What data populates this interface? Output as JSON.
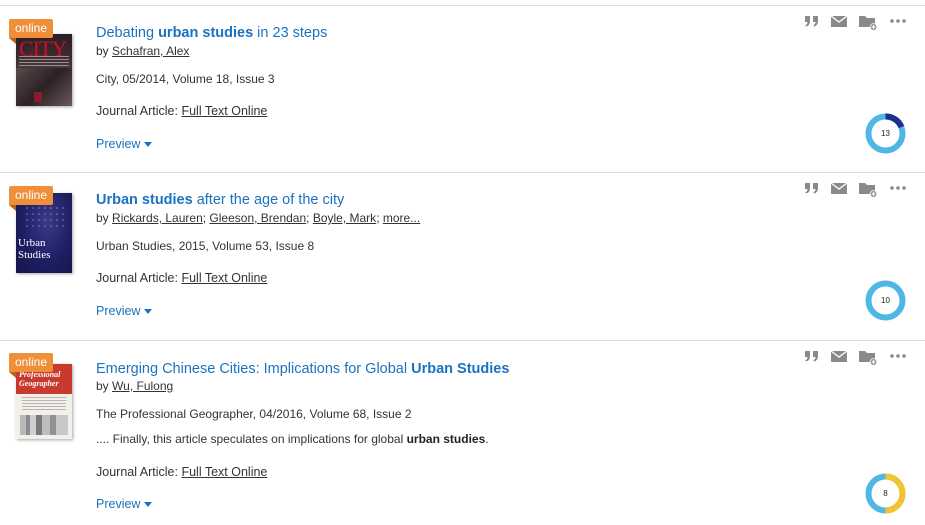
{
  "colors": {
    "link": "#1a73c2",
    "badge": "#f08f3a",
    "donut_blue": "#4fb7e6",
    "donut_dark": "#1d2f8c",
    "donut_yellow": "#f4c430"
  },
  "results": [
    {
      "badge": "online",
      "cover_text": "CITY",
      "title_parts": [
        "Debating ",
        "urban studies",
        " in 23 steps"
      ],
      "by": "by",
      "authors": [
        "Schafran, Alex"
      ],
      "more": "",
      "source": "City, 05/2014, Volume 18, Issue 3",
      "snippet_parts": [],
      "format_label": "Journal Article:",
      "format_link": "Full Text Online",
      "preview": "Preview",
      "score": "13",
      "icons": [
        "quote-icon",
        "mail-icon",
        "folder-add-icon",
        "more-icon"
      ]
    },
    {
      "badge": "online",
      "cover_text": "Urban Studies",
      "title_parts": [
        "",
        "Urban studies",
        " after the age of the city"
      ],
      "by": "by",
      "authors": [
        "Rickards, Lauren",
        "Gleeson, Brendan",
        "Boyle, Mark"
      ],
      "more": "more...",
      "source": "Urban Studies, 2015, Volume 53, Issue 8",
      "snippet_parts": [],
      "format_label": "Journal Article:",
      "format_link": "Full Text Online",
      "preview": "Preview",
      "score": "10",
      "icons": [
        "quote-icon",
        "mail-icon",
        "folder-add-icon",
        "more-icon"
      ]
    },
    {
      "badge": "online",
      "cover_text": "Professional Geographer",
      "title_parts": [
        "Emerging Chinese Cities: Implications for Global ",
        "Urban Studies",
        ""
      ],
      "by": "by",
      "authors": [
        "Wu, Fulong"
      ],
      "more": "",
      "source": "The Professional Geographer, 04/2016, Volume 68, Issue 2",
      "snippet_parts": [
        ".... Finally, this article speculates on implications for global ",
        "urban studies",
        "."
      ],
      "format_label": "Journal Article:",
      "format_link": "Full Text Online",
      "preview": "Preview",
      "score": "8",
      "icons": [
        "quote-icon",
        "mail-icon",
        "folder-add-icon",
        "more-icon"
      ]
    }
  ]
}
